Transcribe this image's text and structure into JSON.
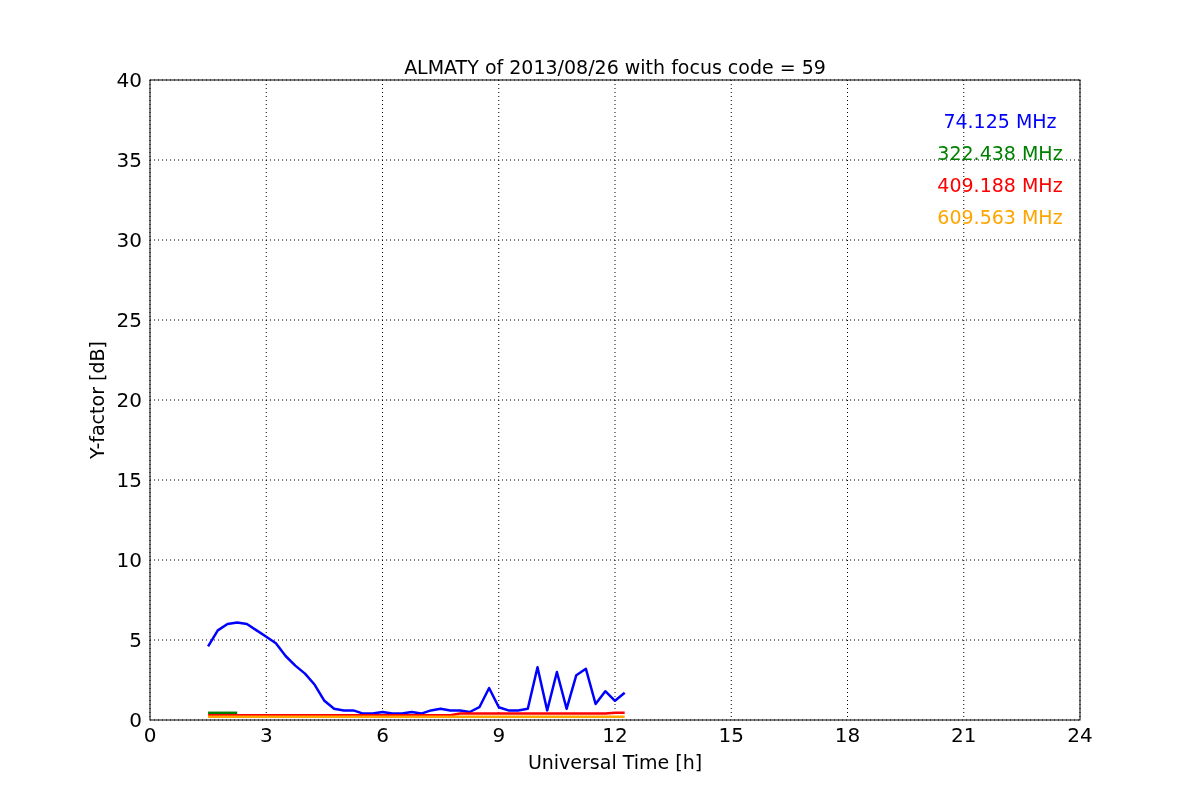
{
  "chart_data": {
    "type": "line",
    "title": "ALMATY of 2013/08/26 with focus code = 59",
    "xlabel": "Universal Time [h]",
    "ylabel": "Y-factor [dB]",
    "x": [
      1.5,
      1.75,
      2,
      2.25,
      2.5,
      2.75,
      3,
      3.25,
      3.5,
      3.75,
      4,
      4.25,
      4.5,
      4.75,
      5,
      5.25,
      5.5,
      5.75,
      6,
      6.25,
      6.5,
      6.75,
      7,
      7.25,
      7.5,
      7.75,
      8,
      8.25,
      8.5,
      8.75,
      9,
      9.25,
      9.5,
      9.75,
      10,
      10.25,
      10.5,
      10.75,
      11,
      11.25,
      11.5,
      11.75,
      12,
      12.25
    ],
    "series": [
      {
        "name": "74.125 MHz",
        "color": "#0000ff",
        "values": [
          4.6,
          5.6,
          6.0,
          6.1,
          6.0,
          5.6,
          5.2,
          4.8,
          4.0,
          3.4,
          2.9,
          2.2,
          1.2,
          0.7,
          0.6,
          0.6,
          0.4,
          0.4,
          0.5,
          0.4,
          0.4,
          0.5,
          0.4,
          0.6,
          0.7,
          0.6,
          0.6,
          0.5,
          0.8,
          2.0,
          0.8,
          0.6,
          0.6,
          0.7,
          3.3,
          0.6,
          3.0,
          0.7,
          2.8,
          3.2,
          1.0,
          1.8,
          1.2,
          1.7
        ]
      },
      {
        "name": "322.438 MHz",
        "color": "#008000",
        "values": [
          0.45,
          0.45,
          0.45,
          0.45,
          null,
          null,
          null,
          null,
          null,
          null,
          null,
          null,
          null,
          null,
          null,
          null,
          null,
          null,
          null,
          null,
          null,
          null,
          null,
          null,
          null,
          null,
          null,
          null,
          null,
          null,
          null,
          null,
          null,
          null,
          null,
          null,
          null,
          null,
          null,
          null,
          null,
          null,
          null,
          null
        ]
      },
      {
        "name": "409.188 MHz",
        "color": "#ff0000",
        "values": [
          0.3,
          0.3,
          0.3,
          0.3,
          0.3,
          0.3,
          0.3,
          0.3,
          0.3,
          0.3,
          0.3,
          0.3,
          0.3,
          0.3,
          0.3,
          0.3,
          0.3,
          0.3,
          0.3,
          0.3,
          0.3,
          0.3,
          0.3,
          0.3,
          0.3,
          0.3,
          0.4,
          0.4,
          0.4,
          0.4,
          0.4,
          0.4,
          0.4,
          0.4,
          0.4,
          0.4,
          0.4,
          0.4,
          0.4,
          0.4,
          0.4,
          0.4,
          0.45,
          0.45
        ]
      },
      {
        "name": "609.563 MHz",
        "color": "#ffa500",
        "values": [
          0.2,
          0.2,
          0.2,
          0.2,
          0.2,
          0.2,
          0.2,
          0.2,
          0.2,
          0.2,
          0.2,
          0.2,
          0.2,
          0.2,
          0.2,
          0.2,
          0.2,
          0.2,
          0.2,
          0.2,
          0.2,
          0.2,
          0.2,
          0.2,
          0.2,
          0.2,
          0.2,
          0.2,
          0.2,
          0.2,
          0.2,
          0.2,
          0.2,
          0.2,
          0.2,
          0.2,
          0.2,
          0.2,
          0.2,
          0.2,
          0.2,
          0.2,
          0.2,
          0.2
        ]
      }
    ],
    "xlim": [
      0,
      24
    ],
    "ylim": [
      0,
      40
    ],
    "grid": true,
    "xticks": [
      0,
      3,
      6,
      9,
      12,
      15,
      18,
      21,
      24
    ],
    "yticks": [
      0,
      5,
      10,
      15,
      20,
      25,
      30,
      35,
      40
    ]
  }
}
